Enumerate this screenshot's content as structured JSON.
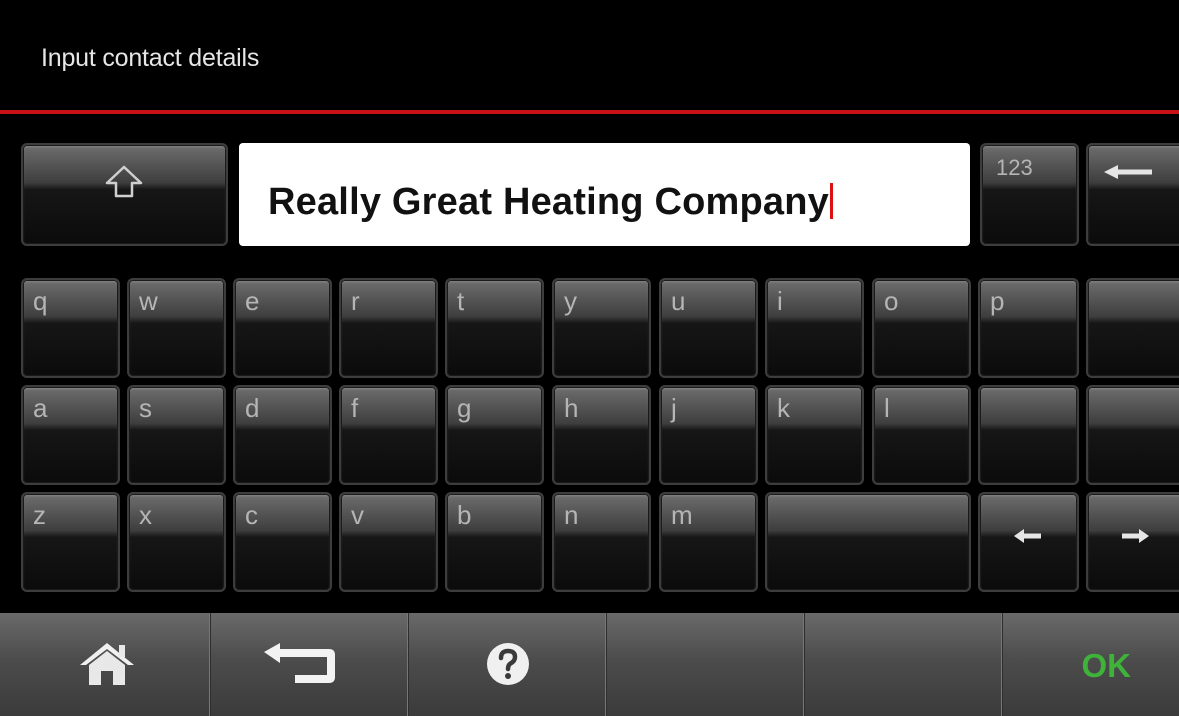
{
  "header": {
    "title": "Input contact details"
  },
  "input": {
    "value": "Really Great Heating Company"
  },
  "keys": {
    "shift_icon": "shift-icon",
    "numbers_label": "123",
    "backspace_icon": "backspace-arrow-icon",
    "row1": [
      "q",
      "w",
      "e",
      "r",
      "t",
      "y",
      "u",
      "i",
      "o",
      "p"
    ],
    "row2": [
      "a",
      "s",
      "d",
      "f",
      "g",
      "h",
      "j",
      "k",
      "l"
    ],
    "row3": [
      "z",
      "x",
      "c",
      "v",
      "b",
      "n",
      "m"
    ],
    "cursor_left_icon": "arrow-left-icon",
    "cursor_right_icon": "arrow-right-icon"
  },
  "footer": {
    "home_icon": "home-icon",
    "back_icon": "back-arrow-icon",
    "help_icon": "help-icon",
    "ok_label": "OK"
  },
  "colors": {
    "accent_red": "#c81018",
    "ok_green": "#3fb23a"
  }
}
